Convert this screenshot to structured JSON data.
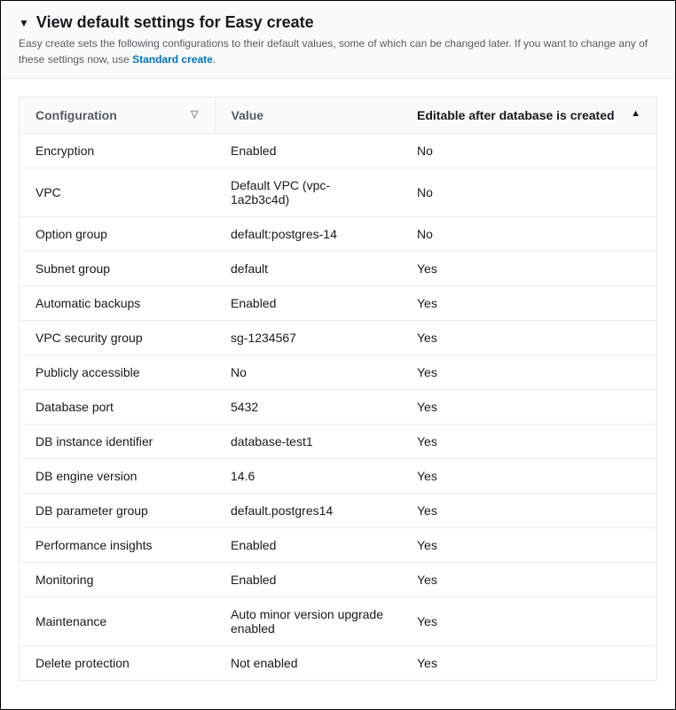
{
  "header": {
    "title": "View default settings for Easy create",
    "description": "Easy create sets the following configurations to their default values, some of which can be changed later. If you want to change any of these settings now, use ",
    "link_text": "Standard create",
    "period": "."
  },
  "table": {
    "columns": {
      "config": "Configuration",
      "value": "Value",
      "editable": "Editable after database is created"
    },
    "rows": [
      {
        "config": "Encryption",
        "value": "Enabled",
        "editable": "No"
      },
      {
        "config": "VPC",
        "value": "Default VPC (vpc-1a2b3c4d)",
        "editable": "No"
      },
      {
        "config": "Option group",
        "value": "default:postgres-14",
        "editable": "No"
      },
      {
        "config": "Subnet group",
        "value": "default",
        "editable": "Yes"
      },
      {
        "config": "Automatic backups",
        "value": "Enabled",
        "editable": "Yes"
      },
      {
        "config": "VPC security group",
        "value": "sg-1234567",
        "editable": "Yes"
      },
      {
        "config": "Publicly accessible",
        "value": "No",
        "editable": "Yes"
      },
      {
        "config": "Database port",
        "value": "5432",
        "editable": "Yes"
      },
      {
        "config": "DB instance identifier",
        "value": "database-test1",
        "editable": "Yes"
      },
      {
        "config": "DB engine version",
        "value": "14.6",
        "editable": "Yes"
      },
      {
        "config": "DB parameter group",
        "value": "default.postgres14",
        "editable": "Yes"
      },
      {
        "config": "Performance insights",
        "value": "Enabled",
        "editable": "Yes"
      },
      {
        "config": "Monitoring",
        "value": "Enabled",
        "editable": "Yes"
      },
      {
        "config": "Maintenance",
        "value": "Auto minor version upgrade enabled",
        "editable": "Yes"
      },
      {
        "config": "Delete protection",
        "value": "Not enabled",
        "editable": "Yes"
      }
    ]
  }
}
